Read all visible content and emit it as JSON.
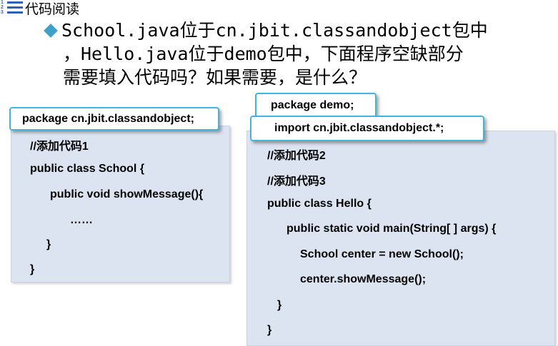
{
  "slide": {
    "title": "代码阅读",
    "question_lines": [
      "School.java位于cn.jbit.classandobject包中",
      "，Hello.java位于demo包中，下面程序空缺部分",
      "需要填入代码吗？如果需要，是什么？"
    ]
  },
  "left_panel": {
    "package_label": "package cn.jbit.classandobject;",
    "lines": [
      "//添加代码1",
      "public class School {",
      "public void showMessage(){",
      "……",
      "}",
      "}"
    ]
  },
  "right_panel": {
    "package_label": "package demo;",
    "import_label": "import cn.jbit.classandobject.*;",
    "lines": [
      "//添加代码2",
      "//添加代码3",
      "public class Hello {",
      "public static void main(String[ ] args) {",
      "School center = new School();",
      "center.showMessage();",
      "}",
      "}"
    ]
  },
  "colors": {
    "accent": "#42b5de",
    "code_bg": "#dbe4f0",
    "bullet": "#3ea0c8"
  }
}
